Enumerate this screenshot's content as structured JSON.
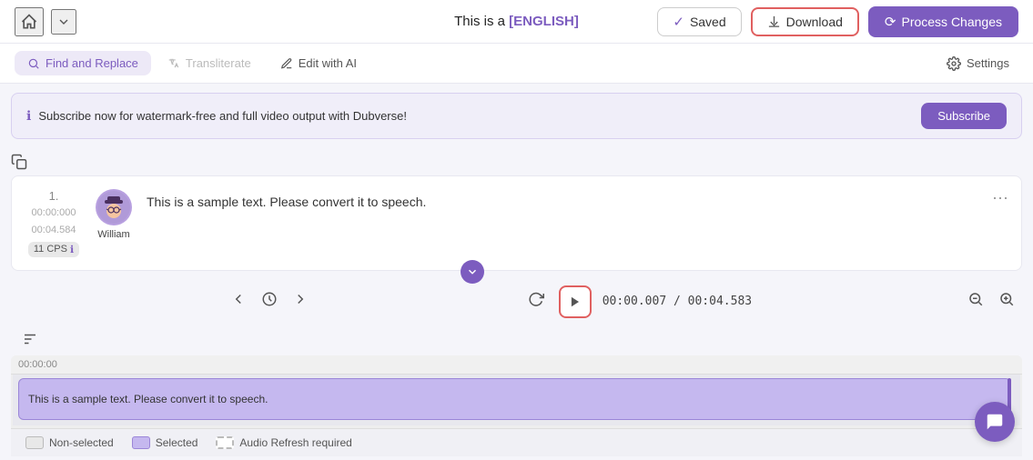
{
  "header": {
    "title": "This is a",
    "language": "[ENGLISH]",
    "saved_label": "Saved",
    "download_label": "Download",
    "process_label": "Process Changes"
  },
  "toolbar": {
    "find_replace_label": "Find and Replace",
    "transliterate_label": "Transliterate",
    "edit_ai_label": "Edit with AI",
    "settings_label": "Settings"
  },
  "banner": {
    "text": "Subscribe now for watermark-free and full video output with Dubverse!",
    "subscribe_label": "Subscribe"
  },
  "script": {
    "index": "1.",
    "time_start": "00:00:000",
    "time_end": "00:04.584",
    "cps": "11 CPS",
    "speaker": "William",
    "text": "This is a sample text. Please convert it to speech."
  },
  "player": {
    "current_time": "00:00.007",
    "total_time": "00:04.583"
  },
  "timeline": {
    "timestamp": "00:00:00",
    "block_text": "This is a sample text. Please convert it to speech."
  },
  "legend": {
    "non_selected_label": "Non-selected",
    "selected_label": "Selected",
    "audio_refresh_label": "Audio Refresh required"
  }
}
